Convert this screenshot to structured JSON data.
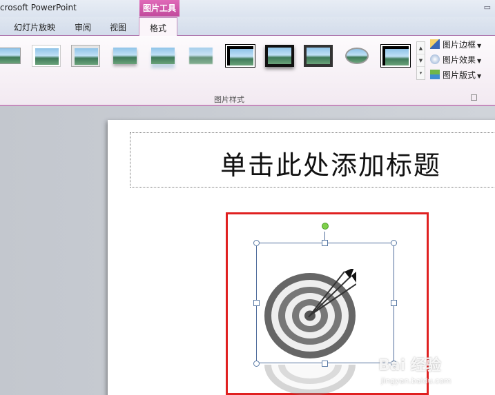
{
  "window": {
    "title": "crosoft PowerPoint",
    "context_tab_group": "图片工具"
  },
  "tabs": [
    {
      "label": "幻灯片放映"
    },
    {
      "label": "审阅"
    },
    {
      "label": "视图"
    },
    {
      "label": "格式",
      "active": true
    }
  ],
  "ribbon": {
    "picture_styles_group_label": "图片样式",
    "commands": [
      {
        "label": "图片边框",
        "icon": "pencil-border-icon"
      },
      {
        "label": "图片效果",
        "icon": "picture-effects-icon"
      },
      {
        "label": "图片版式",
        "icon": "picture-layout-icon"
      }
    ],
    "style_gallery_count": 11
  },
  "slide": {
    "title_placeholder": "单击此处添加标题",
    "image": "target-with-arrows",
    "highlight_color": "#e02020"
  },
  "watermark": {
    "brand": "Bai 经验",
    "url": "jingyan.baidu.com"
  }
}
